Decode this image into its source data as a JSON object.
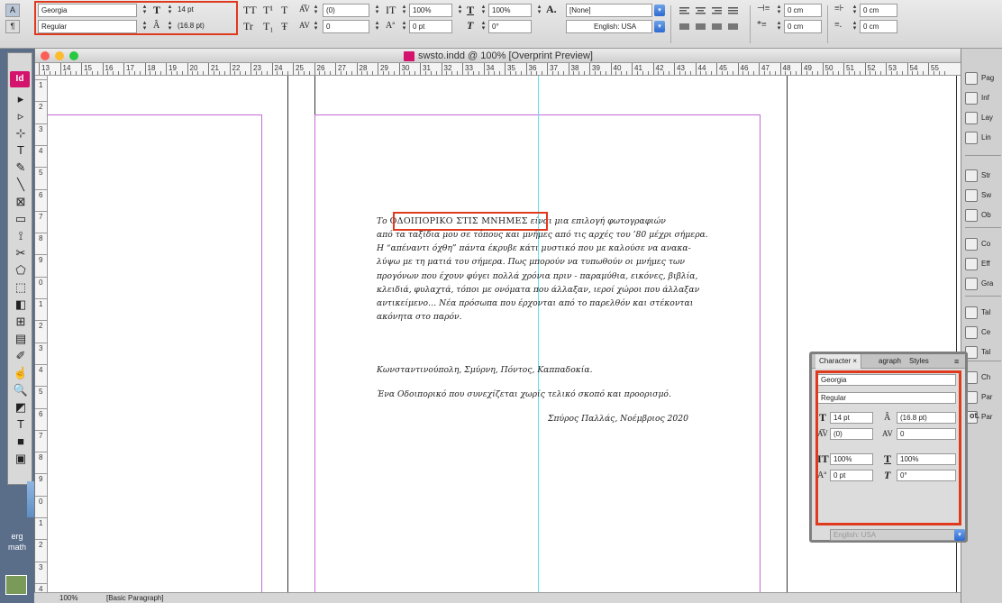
{
  "control_bar": {
    "mode_char": "A",
    "mode_para": "¶",
    "font_family": "Georgia",
    "font_style": "Regular",
    "font_size": "14 pt",
    "leading": "(16.8 pt)",
    "kerning": "(0)",
    "tracking": "0",
    "vscale": "100%",
    "hscale": "100%",
    "baseline": "0 pt",
    "skew": "0°",
    "char_style": "[None]",
    "language": "English: USA",
    "indent_left": "0 cm",
    "indent_first": "0 cm",
    "space_before": "0 cm",
    "space_after": "0 cm",
    "glyph_tt": "TT",
    "glyph_tsup": "T¹",
    "glyph_t": "T",
    "glyph_tr": "Tr",
    "glyph_tsub": "T₁",
    "glyph_tstrike": "Ŧ",
    "glyph_a": "A."
  },
  "tools": [
    "▸",
    "▹",
    "⊹",
    "T",
    "✎",
    "╲",
    "⊠",
    "▭",
    "⟟",
    "✂",
    "⬠",
    "⬚",
    "◧",
    "⊞",
    "▤",
    "✐",
    "☝",
    "🔍",
    "◩",
    "T",
    "■",
    "▣"
  ],
  "id_badge": "Id",
  "desktop": {
    "label1": "erg",
    "label2": "math"
  },
  "document": {
    "title": "swsto.indd @ 100% [Overprint Preview]",
    "ruler_labels": [
      "13",
      "14",
      "15",
      "16",
      "17",
      "18",
      "19",
      "20",
      "21",
      "22",
      "23",
      "24",
      "25",
      "26",
      "27",
      "28",
      "29",
      "30",
      "31",
      "32",
      "33",
      "34",
      "35",
      "36",
      "37",
      "38",
      "39",
      "40",
      "41",
      "42",
      "43",
      "44",
      "45",
      "46",
      "47",
      "48",
      "49",
      "50",
      "51",
      "52",
      "53",
      "54",
      "55"
    ],
    "vruler_labels": [
      "1",
      "2",
      "3",
      "4",
      "5",
      "6",
      "7",
      "8",
      "9",
      "0",
      "1",
      "2",
      "3",
      "4",
      "5",
      "6",
      "7",
      "8",
      "9",
      "0",
      "1",
      "2",
      "3",
      "4"
    ],
    "text_lead": "Το ",
    "text_title": "ΟΔΟΙΠΟΡΙΚΟ ΣΤΙΣ ΜΝΗΜΕΣ",
    "text_line1_rest": " είναι μια επιλογή φωτογραφιών",
    "lines": [
      "από τα ταξίδια μου σε τόπους και μνήμες από τις αρχές του ’80 μέχρι σήμερα.",
      "Η “απέναντι όχθη” πάντα έκρυβε κάτι μυστικό που με καλούσε να ανακα-",
      "λύψω με τη ματιά του σήμερα. Πως μπορούν να τυπωθούν οι μνήμες των",
      "προγόνων που έχουν φύγει πολλά χρόνια πριν - παραμύθια, εικόνες, βιβλία,",
      "κλειδιά, φυλαχτά, τόποι με ονόματα που άλλαξαν, ιεροί χώροι που άλλαξαν",
      "αντικείμενο… Νέα πρόσωπα που έρχονται από το παρελθόν και στέκονται",
      "ακόνητα στο παρόν."
    ],
    "places": "Κωνσταντινούπολη, Σμύρνη, Πόντος, Καππαδοκία.",
    "closing": "Ένα Οδοιπορικό που συνεχίζεται χωρίς τελικό σκοπό και προορισμό.",
    "signature": "Σπύρος Παλλάς, Νοέμβριος 2020"
  },
  "right_dock": [
    {
      "name": "pages",
      "label": "Pag"
    },
    {
      "name": "info",
      "label": "Inf"
    },
    {
      "name": "layers",
      "label": "Lay"
    },
    {
      "name": "links",
      "label": "Lin"
    },
    {
      "name": "stroke",
      "label": "Str"
    },
    {
      "name": "swatches",
      "label": "Sw"
    },
    {
      "name": "object-styles",
      "label": "Ob"
    },
    {
      "name": "color",
      "label": "Co"
    },
    {
      "name": "effects",
      "label": "Eff"
    },
    {
      "name": "gradient",
      "label": "Gra"
    },
    {
      "name": "table",
      "label": "Tal"
    },
    {
      "name": "cell-styles",
      "label": "Ce"
    },
    {
      "name": "table-styles",
      "label": "Tal"
    },
    {
      "name": "character",
      "label": "Ch"
    },
    {
      "name": "paragraph",
      "label": "Par"
    },
    {
      "name": "paragraph-styles",
      "label": "Par"
    }
  ],
  "char_panel": {
    "tab_character": "Character",
    "tab_paragraph": "agraph",
    "tab_styles": "Styles",
    "font_family": "Georgia",
    "font_style": "Regular",
    "font_size": "14 pt",
    "leading": "(16.8 pt)",
    "kerning": "(0)",
    "tracking": "0",
    "vscale": "100%",
    "hscale": "100%",
    "baseline": "0 pt",
    "skew": "0°",
    "language": "English: USA",
    "side_label": "ot."
  },
  "status": {
    "zoom": "100%",
    "page": "[Basic Paragraph]"
  },
  "colors": {
    "highlight_red": "#e03a1e",
    "margin_magenta": "#c36bd6",
    "guide_cyan": "#5fe0e8",
    "indesign_pink": "#d4136d"
  }
}
